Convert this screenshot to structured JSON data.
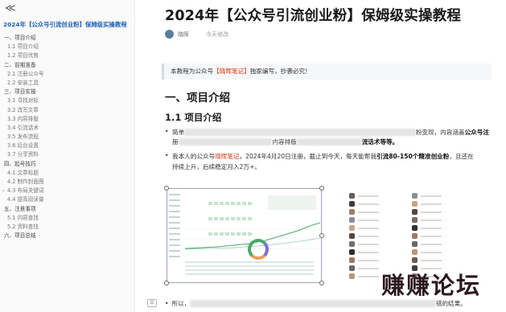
{
  "sidebar": {
    "collapse_glyph": "≪",
    "toc_title": "2024年【公众号引流创业粉】保姆级实操教程",
    "items": [
      {
        "label": "一、项目介绍",
        "level": 1
      },
      {
        "label": "1.1 项目介绍",
        "level": 2
      },
      {
        "label": "1.2 项目优势",
        "level": 2
      },
      {
        "label": "二、前期准备",
        "level": 1
      },
      {
        "label": "2.1 注册公众号",
        "level": 2
      },
      {
        "label": "2.2 安装工具",
        "level": 2
      },
      {
        "label": "三、项目实操",
        "level": 1
      },
      {
        "label": "3.1 寻找对标",
        "level": 2
      },
      {
        "label": "3.2 改写文章",
        "level": 2
      },
      {
        "label": "3.3 内容排版",
        "level": 2
      },
      {
        "label": "3.4 引流话术",
        "level": 2
      },
      {
        "label": "3.5 发布流程",
        "level": 2
      },
      {
        "label": "3.6 后台设置",
        "level": 2
      },
      {
        "label": "3.7 分享资料",
        "level": 2
      },
      {
        "label": "四、起号技巧",
        "level": 1
      },
      {
        "label": "4.1 文章标题",
        "level": 2
      },
      {
        "label": "4.2 制作封面图",
        "level": 2
      },
      {
        "label": "4.3 布局关键词",
        "level": 2,
        "arrow": "›"
      },
      {
        "label": "4.4 提高阅读量",
        "level": 2
      },
      {
        "label": "五、注意事项",
        "level": 1
      },
      {
        "label": "5.1 内容查找",
        "level": 2
      },
      {
        "label": "5.2 资料查找",
        "level": 2
      },
      {
        "label": "六、项目总结",
        "level": 1
      }
    ]
  },
  "doc": {
    "title": "2024年【公众号引流创业粉】保姆级实操教程",
    "author": "晓晖",
    "updated": "今天修改",
    "quote_prefix": "本教程为公众号",
    "quote_highlight": "【晓晖笔记】",
    "quote_suffix": "独家编写，抄袭必究！",
    "h1": "一、项目介绍",
    "h2": "1.1 项目介绍",
    "bullet1_start": "简单",
    "bullet1_mid": "粉变现，内容涵盖",
    "bullet1_bold": "公众号注",
    "bullet1_line2_a": "册",
    "bullet1_line2_b": "内容排版",
    "bullet1_line2_c": "流话术等等。",
    "bullet2_a": "我本人的公众号",
    "bullet2_red": "晓晖笔记",
    "bullet2_b": "，2024年4月20日注册，截止到今天，每天能帮我",
    "bullet2_bold": "引流80-150个精准创业粉",
    "bullet2_c": "，且还在",
    "bullet2_line2": "持续上升，后续稳定月入2万+。",
    "bullet3_a": "所以，",
    "bullet3_b": "错的结果。",
    "dot": "•",
    "small_icon": "☰"
  },
  "watermark": "赚赚论坛",
  "colors": {
    "accent": "#1f63b8",
    "highlight_red": "#d4380d",
    "chart_green": "#4aa96c"
  }
}
